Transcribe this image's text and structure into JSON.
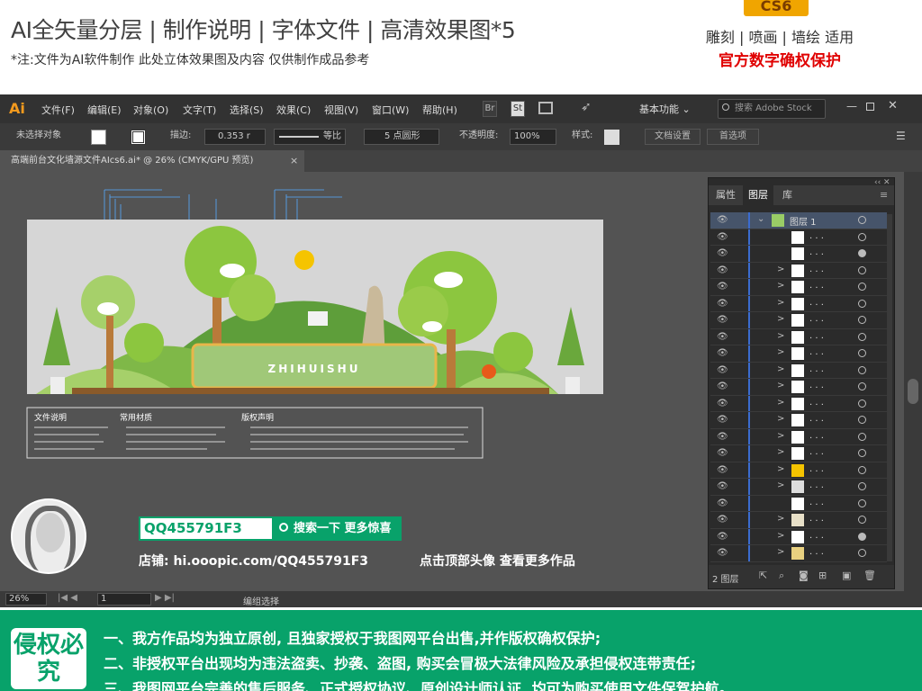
{
  "header": {
    "title": "AI全矢量分层 | 制作说明 | 字体文件 | 高清效果图*5",
    "note": "*注:文件为AI软件制作 此处立体效果图及内容 仅供制作成品参考",
    "badge": "CS6",
    "right_line1": "雕刻 | 喷画 | 墙绘 适用",
    "right_line2": "官方数字确权保护"
  },
  "app": {
    "logo": "Ai",
    "menu": [
      "文件(F)",
      "编辑(E)",
      "对象(O)",
      "文字(T)",
      "选择(S)",
      "效果(C)",
      "视图(V)",
      "窗口(W)",
      "帮助(H)"
    ],
    "br_label": "Br",
    "st_label": "St",
    "workspace": "基本功能",
    "search_placeholder": "搜索 Adobe Stock"
  },
  "control": {
    "selection": "未选择对象",
    "stroke_label": "描边:",
    "stroke_value": "0.353 r",
    "stroke_profile": "等比",
    "brush": "5 点圆形",
    "opacity_label": "不透明度:",
    "opacity_value": "100%",
    "style_label": "样式:",
    "doc_setup": "文档设置",
    "preferences": "首选项"
  },
  "document": {
    "tab": "高端前台文化墙源文件AIcs6.ai* @ 26% (CMYK/GPU 预览)",
    "close": "×"
  },
  "artwork": {
    "brand": "ZHIHUISHU",
    "sec1": "文件说明",
    "sec2": "常用材质",
    "sec3": "版权声明"
  },
  "shop": {
    "qq": "QQ455791F3",
    "search_btn": "搜索一下 更多惊喜",
    "line": "店铺: hi.ooopic.com/QQ455791F3",
    "cta": "点击顶部头像 查看更多作品"
  },
  "statusbar": {
    "zoom": "26%",
    "page": "1",
    "mode": "编组选择"
  },
  "panel": {
    "tabs": [
      "属性",
      "图层",
      "库"
    ],
    "layer_name": "图层 1",
    "sublayer_name": ". . .",
    "footer_count": "2 图层",
    "rows": [
      {
        "chev": "",
        "thumb": "#ffffff",
        "circ": "open"
      },
      {
        "chev": "",
        "thumb": "#ffffff",
        "circ": "filled"
      },
      {
        "chev": ">",
        "thumb": "#ffffff",
        "circ": "open"
      },
      {
        "chev": ">",
        "thumb": "#ffffff",
        "circ": "open"
      },
      {
        "chev": ">",
        "thumb": "#ffffff",
        "circ": "open"
      },
      {
        "chev": ">",
        "thumb": "#ffffff",
        "circ": "open"
      },
      {
        "chev": ">",
        "thumb": "#ffffff",
        "circ": "open"
      },
      {
        "chev": ">",
        "thumb": "#ffffff",
        "circ": "open"
      },
      {
        "chev": ">",
        "thumb": "#ffffff",
        "circ": "open"
      },
      {
        "chev": ">",
        "thumb": "#ffffff",
        "circ": "open"
      },
      {
        "chev": ">",
        "thumb": "#ffffff",
        "circ": "open"
      },
      {
        "chev": ">",
        "thumb": "#ffffff",
        "circ": "open"
      },
      {
        "chev": ">",
        "thumb": "#ffffff",
        "circ": "open"
      },
      {
        "chev": ">",
        "thumb": "#ffffff",
        "circ": "open"
      },
      {
        "chev": ">",
        "thumb": "#f5c400",
        "circ": "open"
      },
      {
        "chev": ">",
        "thumb": "#dddddd",
        "circ": "open"
      },
      {
        "chev": "",
        "thumb": "#ffffff",
        "circ": "open"
      },
      {
        "chev": ">",
        "thumb": "#e8e0c8",
        "circ": "open"
      },
      {
        "chev": ">",
        "thumb": "#ffffff",
        "circ": "filled"
      },
      {
        "chev": ">",
        "thumb": "#e8d080",
        "circ": "open"
      }
    ]
  },
  "banner": {
    "badge": "侵权必究",
    "line1": "一、我方作品均为独立原创, 且独家授权于我图网平台出售,并作版权确权保护;",
    "line2": "二、非授权平台出现均为违法盗卖、抄袭、盗图, 购买会冒极大法律风险及承担侵权连带责任;",
    "line3": "三、我图网平台完善的售后服务、正式授权协议、原创设计师认证, 均可为购买使用文件保驾护航。"
  },
  "colors": {
    "accent_orange": "#f39a1e",
    "green_banner": "#08a26a",
    "layer_blue": "#3b6ccf",
    "warning_red": "#e00000"
  }
}
